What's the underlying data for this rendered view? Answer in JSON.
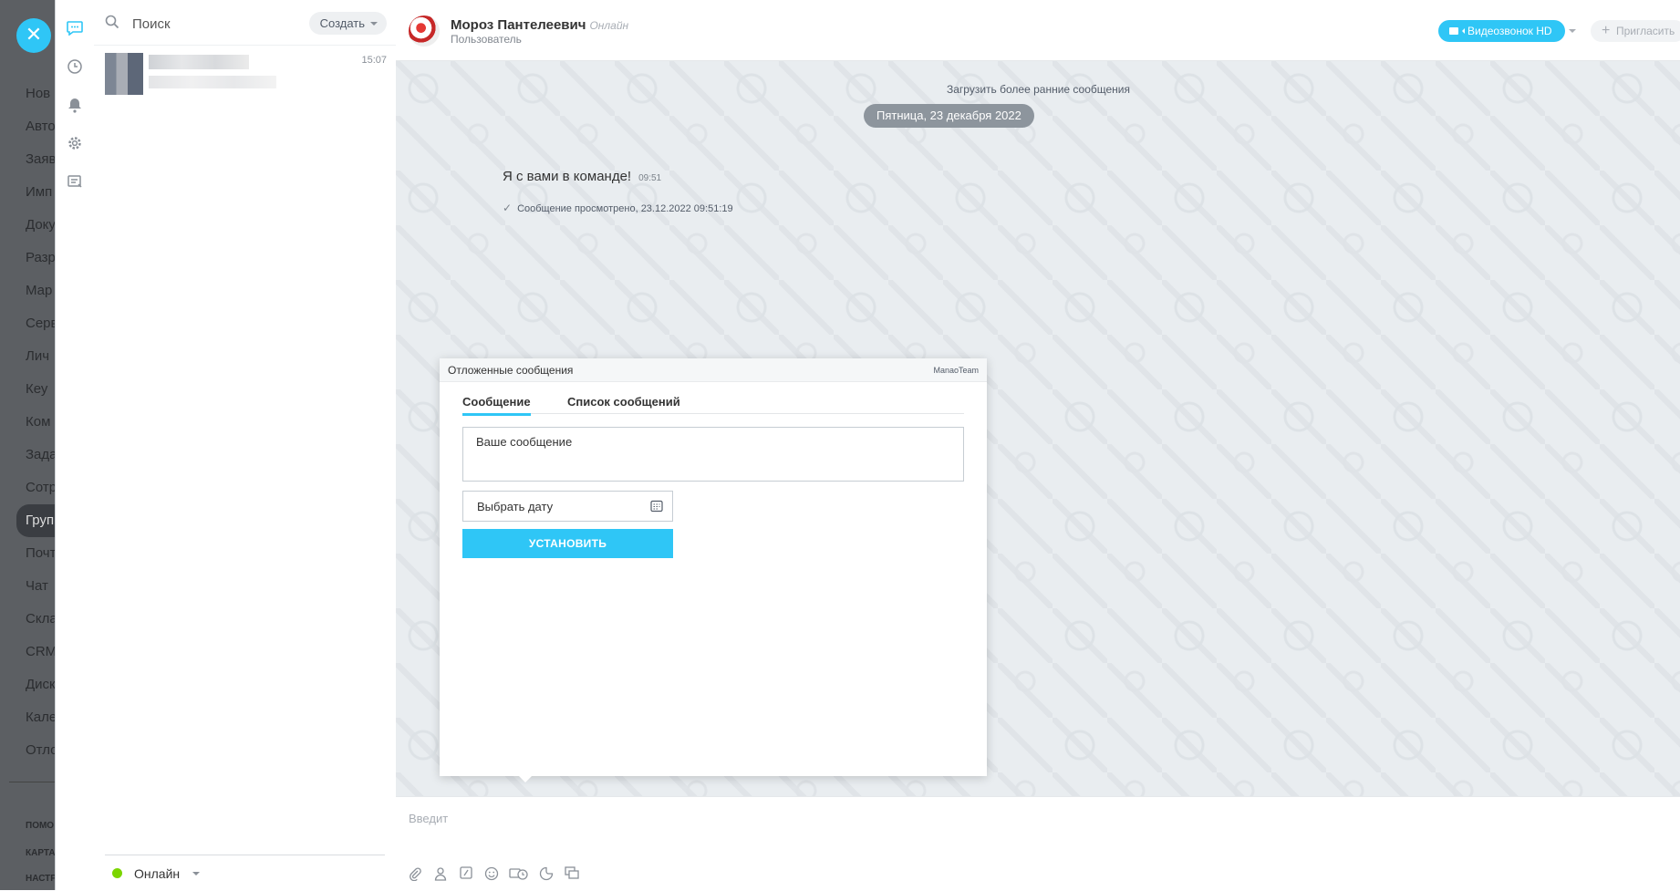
{
  "background_menu": {
    "items": [
      "Нов",
      "Авто",
      "Заяв",
      "Имп",
      "Доку",
      "Разр",
      "Мар",
      "Серв",
      "Лич",
      "Кеу",
      "Ком",
      "Зада",
      "Сотр",
      "Груп",
      "Почт",
      "Чат",
      "Скла",
      "CRM",
      "Диск",
      "Кале",
      "Отло"
    ],
    "footer": [
      "ПОМО",
      "КАРТА",
      "НАСТР"
    ]
  },
  "close_label": "✕",
  "sidebar": {
    "search_placeholder": "Поиск",
    "create_label": "Создать",
    "recent_time": "15:07",
    "status_label": "Онлайн"
  },
  "dialog": {
    "name": "Мороз Пантелеевич",
    "online": "Онлайн",
    "role": "Пользователь",
    "video_label": "Видеозвонок HD",
    "invite_label": "Пригласить",
    "load_earlier": "Загрузить более ранние сообщения",
    "date": "Пятница, 23 декабря 2022",
    "message_text": "Я с вами в команде!",
    "message_time": "09:51",
    "seen_text": "Сообщение просмотрено, 23.12.2022 09:51:19",
    "input_placeholder": "Введит"
  },
  "popup": {
    "title": "Отложенные сообщения",
    "brand": "ManaoTeam",
    "tab_message": "Сообщение",
    "tab_list": "Список сообщений",
    "message_placeholder": "Ваше сообщение",
    "date_placeholder": "Выбрать дату",
    "set_label": "УСТАНОВИТЬ"
  },
  "colors": {
    "accent": "#2fc6f6",
    "online": "#7bd500",
    "chat_bg": "#e9edf0"
  }
}
